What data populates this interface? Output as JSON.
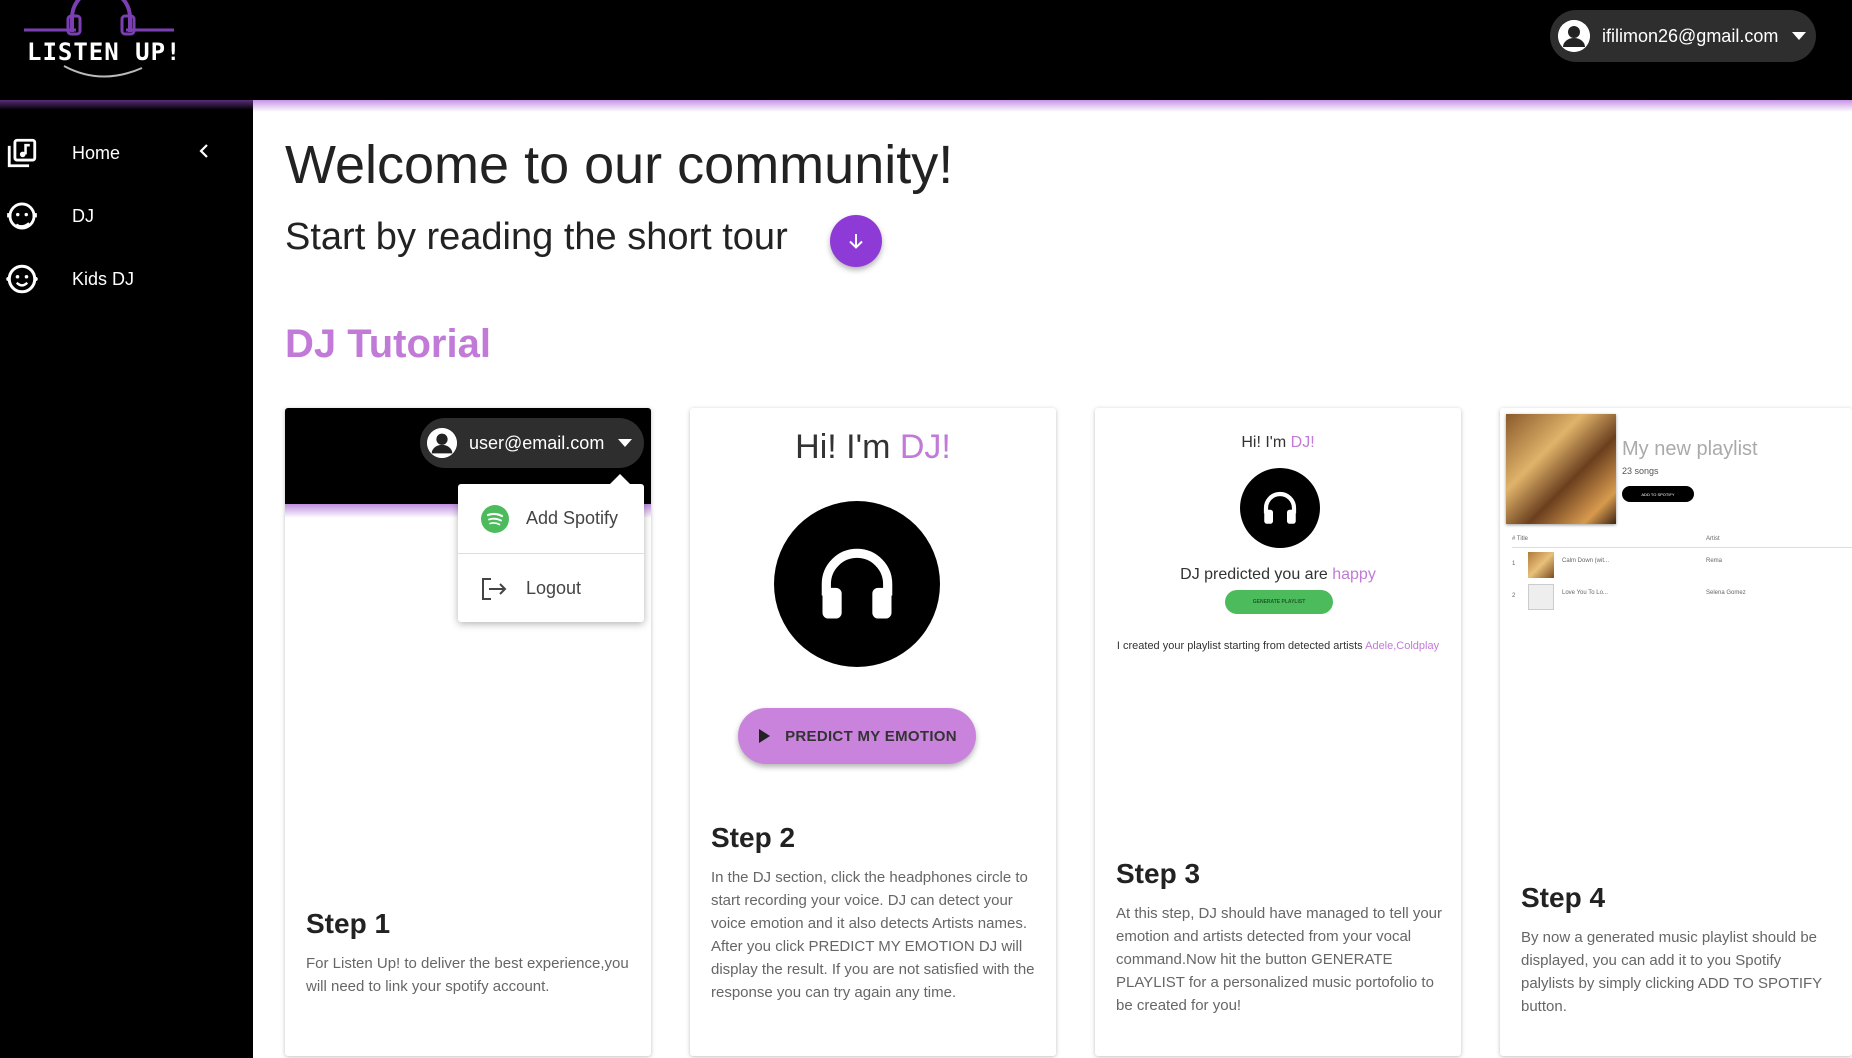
{
  "app": {
    "logo_text": "LISTEN UP!",
    "account_email": "ifilimon26@gmail.com"
  },
  "sidebar": {
    "items": [
      {
        "label": "Home",
        "icon": "library-music-icon"
      },
      {
        "label": "DJ",
        "icon": "face-headset-icon"
      },
      {
        "label": "Kids DJ",
        "icon": "child-face-icon"
      }
    ]
  },
  "main": {
    "welcome": "Welcome to our community!",
    "subtitle": "Start by reading the short tour",
    "section_title": "DJ Tutorial"
  },
  "steps": [
    {
      "title": "Step 1",
      "text": "For Listen Up! to deliver the best experience,you will need to link your spotify account.",
      "preview": {
        "email": "user@email.com",
        "menu": [
          "Add Spotify",
          "Logout"
        ]
      }
    },
    {
      "title": "Step 2",
      "text": "In the DJ section, click the headphones circle to start recording your voice. DJ can detect your voice emotion and it also detects Artists names. After you click PREDICT MY EMOTION DJ will display the result. If you are not satisfied with the response you can try again any time.",
      "preview": {
        "greeting": "Hi! I'm ",
        "greeting_name": "DJ!",
        "button": "PREDICT MY EMOTION"
      }
    },
    {
      "title": "Step 3",
      "text": "At this step, DJ should have managed to tell your emotion and artists detected from your vocal command.Now hit the button GENERATE PLAYLIST for a personalized music portofolio to be created for you!",
      "preview": {
        "greeting": "Hi! I'm ",
        "greeting_name": "DJ!",
        "predicted": "DJ predicted you are ",
        "emotion": "happy",
        "button": "GENERATE PLAYLIST",
        "created": "I created your playlist starting from detected artists ",
        "artists": "Adele,Coldplay"
      }
    },
    {
      "title": "Step 4",
      "text": "By now a generated music playlist should be displayed, you can add it to you Spotify palylists by simply clicking ADD TO SPOTIFY button.",
      "preview": {
        "playlist_title": "My new playlist",
        "song_count": "23 songs",
        "button": "ADD TO SPOTIFY",
        "col_title": "# Title",
        "col_artist": "Artist",
        "rows": [
          {
            "idx": "1",
            "song": "Calm Down (wit...",
            "artist": "Rema"
          },
          {
            "idx": "2",
            "song": "Love You To Lo...",
            "artist": "Selena Gomez"
          }
        ]
      }
    }
  ],
  "colors": {
    "accent_purple": "#8e3ad6",
    "lavender": "#c27ad8",
    "sidebar_bg": "#000000",
    "green": "#4cbb5c"
  }
}
